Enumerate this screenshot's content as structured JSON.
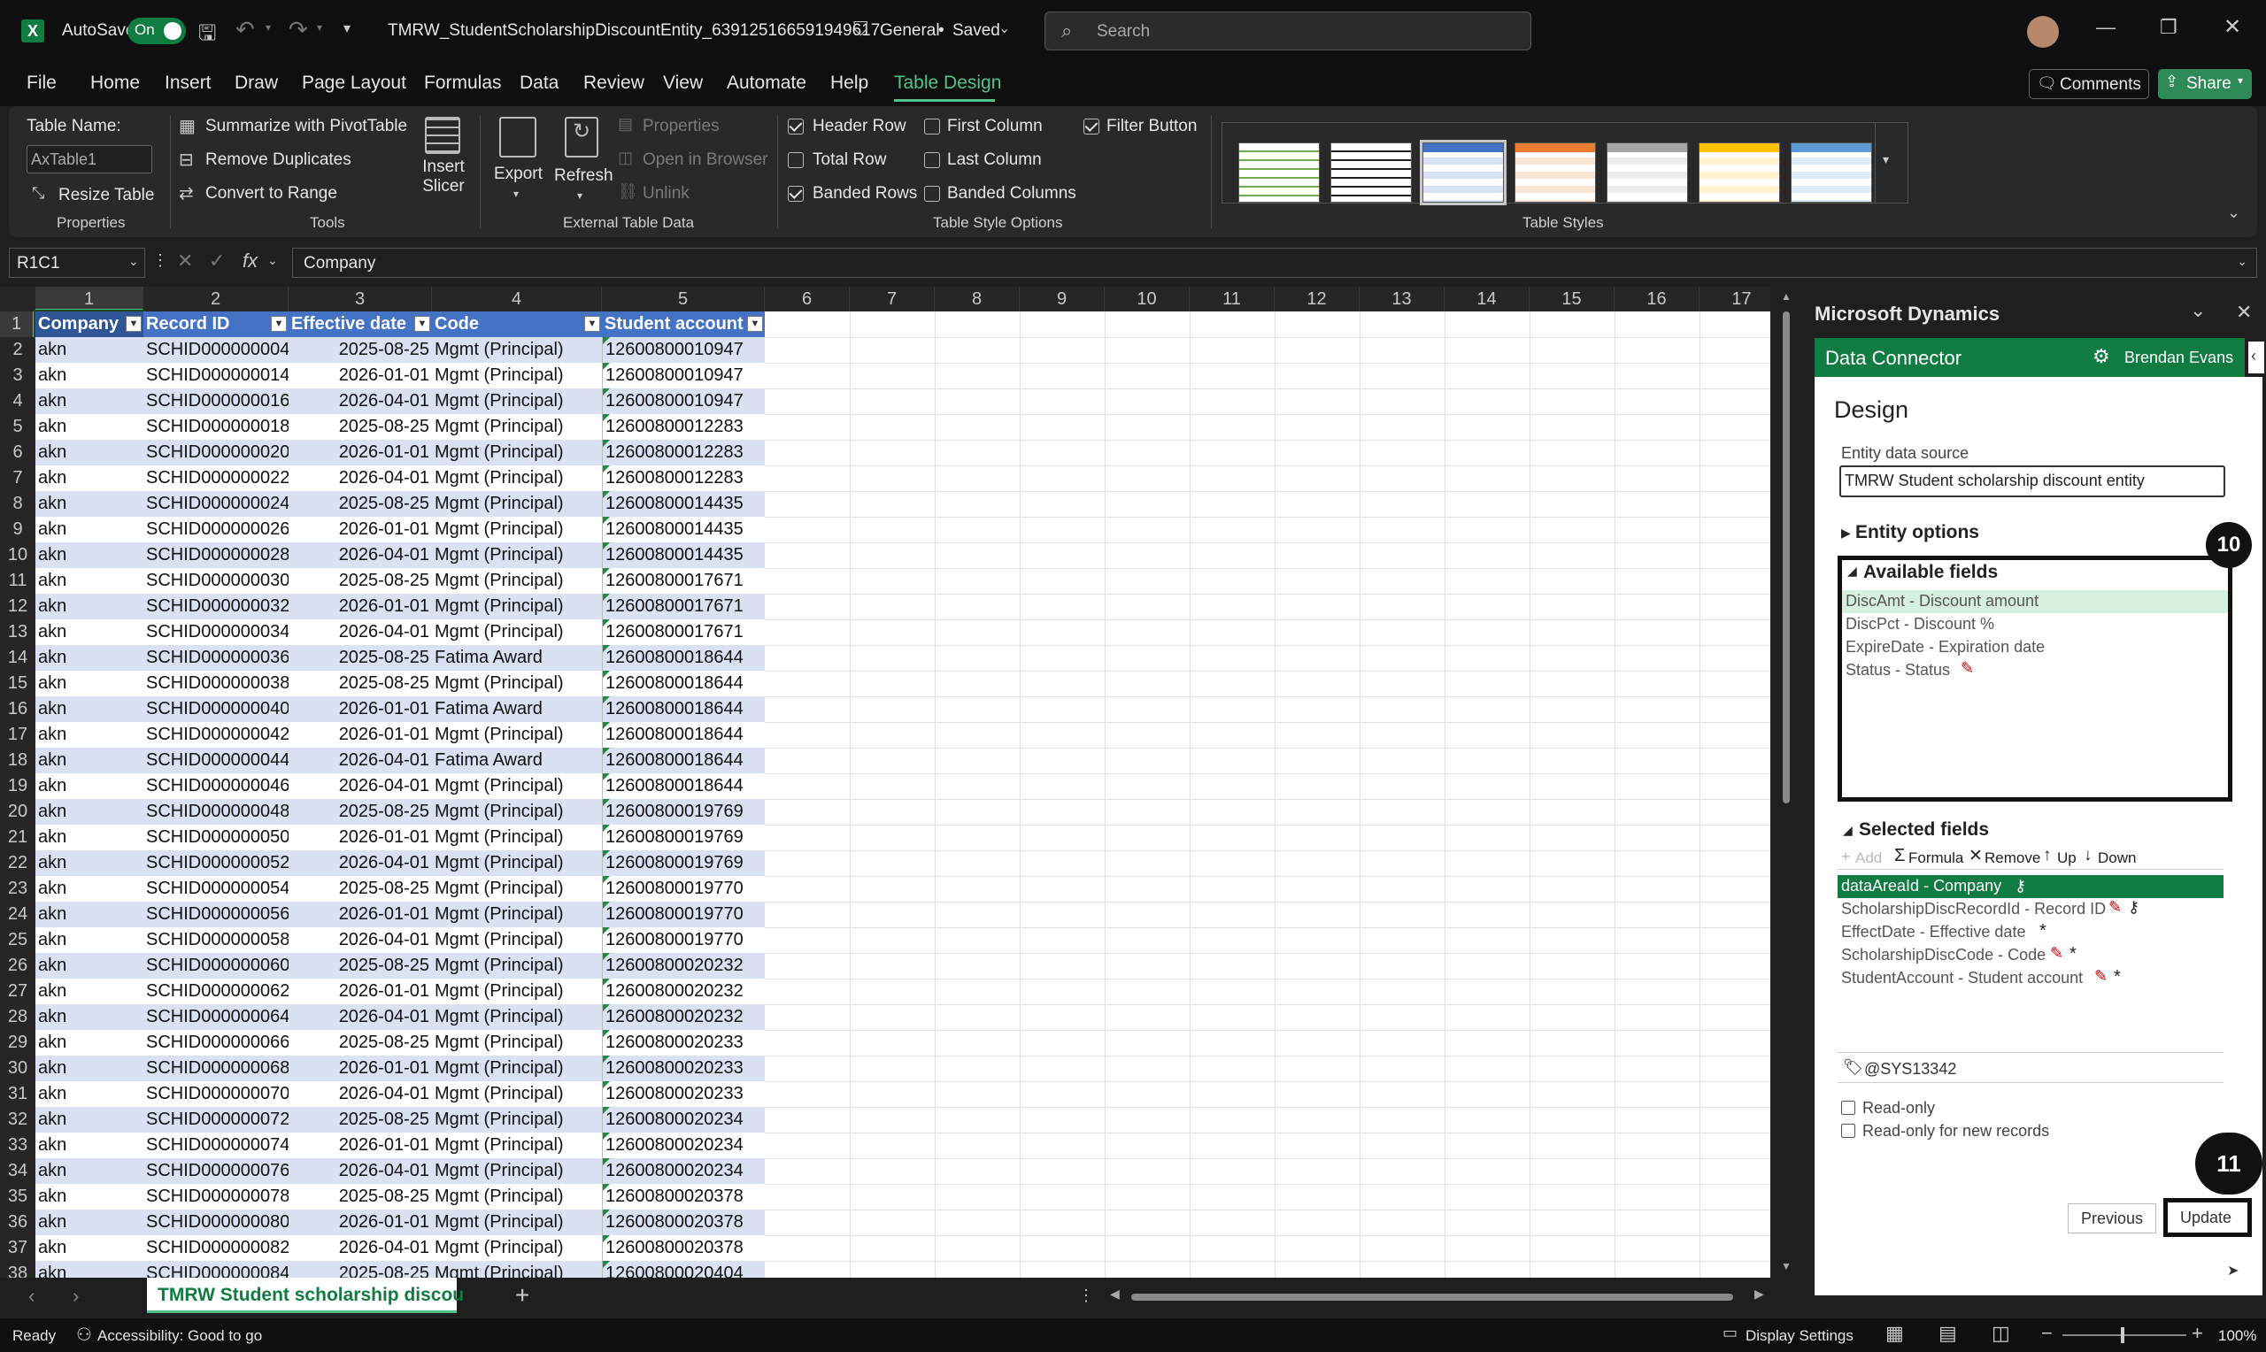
{
  "titlebar": {
    "autosave_label": "AutoSave",
    "autosave_state": "On",
    "filename": "TMRW_StudentScholarshipDiscountEntity_639125166591949617",
    "sensitivity": "General",
    "save_state": "Saved",
    "search_placeholder": "Search"
  },
  "menu": [
    "File",
    "Home",
    "Insert",
    "Draw",
    "Page Layout",
    "Formulas",
    "Data",
    "Review",
    "View",
    "Automate",
    "Help",
    "Table Design"
  ],
  "menu_active": "Table Design",
  "menu_buttons": {
    "comments": "Comments",
    "share": "Share"
  },
  "ribbon": {
    "properties": {
      "table_name_label": "Table Name:",
      "table_name_value": "AxTable1",
      "resize": "Resize Table",
      "group": "Properties"
    },
    "tools": {
      "pivot": "Summarize with PivotTable",
      "dupes": "Remove Duplicates",
      "range": "Convert to Range",
      "slicer": "Insert Slicer",
      "group": "Tools"
    },
    "external": {
      "export": "Export",
      "refresh": "Refresh",
      "props": "Properties",
      "browser": "Open in Browser",
      "unlink": "Unlink",
      "group": "External Table Data"
    },
    "style_options": {
      "header_row": "Header Row",
      "total_row": "Total Row",
      "banded_rows": "Banded Rows",
      "first_column": "First Column",
      "last_column": "Last Column",
      "banded_columns": "Banded Columns",
      "filter_button": "Filter Button",
      "group": "Table Style Options"
    },
    "styles": {
      "group": "Table Styles"
    }
  },
  "formula_bar": {
    "name_box": "R1C1",
    "content": "Company"
  },
  "columns": [
    "1",
    "2",
    "3",
    "4",
    "5",
    "6",
    "7",
    "8",
    "9",
    "10",
    "11",
    "12",
    "13",
    "14",
    "15",
    "16",
    "17"
  ],
  "table_headers": [
    "Company",
    "Record ID",
    "Effective date",
    "Code",
    "Student account"
  ],
  "rows": [
    [
      "akn",
      "SCHID000000004",
      "2025-08-25",
      "Mgmt (Principal)",
      "12600800010947"
    ],
    [
      "akn",
      "SCHID000000014",
      "2026-01-01",
      "Mgmt (Principal)",
      "12600800010947"
    ],
    [
      "akn",
      "SCHID000000016",
      "2026-04-01",
      "Mgmt (Principal)",
      "12600800010947"
    ],
    [
      "akn",
      "SCHID000000018",
      "2025-08-25",
      "Mgmt (Principal)",
      "12600800012283"
    ],
    [
      "akn",
      "SCHID000000020",
      "2026-01-01",
      "Mgmt (Principal)",
      "12600800012283"
    ],
    [
      "akn",
      "SCHID000000022",
      "2026-04-01",
      "Mgmt (Principal)",
      "12600800012283"
    ],
    [
      "akn",
      "SCHID000000024",
      "2025-08-25",
      "Mgmt (Principal)",
      "12600800014435"
    ],
    [
      "akn",
      "SCHID000000026",
      "2026-01-01",
      "Mgmt (Principal)",
      "12600800014435"
    ],
    [
      "akn",
      "SCHID000000028",
      "2026-04-01",
      "Mgmt (Principal)",
      "12600800014435"
    ],
    [
      "akn",
      "SCHID000000030",
      "2025-08-25",
      "Mgmt (Principal)",
      "12600800017671"
    ],
    [
      "akn",
      "SCHID000000032",
      "2026-01-01",
      "Mgmt (Principal)",
      "12600800017671"
    ],
    [
      "akn",
      "SCHID000000034",
      "2026-04-01",
      "Mgmt (Principal)",
      "12600800017671"
    ],
    [
      "akn",
      "SCHID000000036",
      "2025-08-25",
      "Fatima Award",
      "12600800018644"
    ],
    [
      "akn",
      "SCHID000000038",
      "2025-08-25",
      "Mgmt (Principal)",
      "12600800018644"
    ],
    [
      "akn",
      "SCHID000000040",
      "2026-01-01",
      "Fatima Award",
      "12600800018644"
    ],
    [
      "akn",
      "SCHID000000042",
      "2026-01-01",
      "Mgmt (Principal)",
      "12600800018644"
    ],
    [
      "akn",
      "SCHID000000044",
      "2026-04-01",
      "Fatima Award",
      "12600800018644"
    ],
    [
      "akn",
      "SCHID000000046",
      "2026-04-01",
      "Mgmt (Principal)",
      "12600800018644"
    ],
    [
      "akn",
      "SCHID000000048",
      "2025-08-25",
      "Mgmt (Principal)",
      "12600800019769"
    ],
    [
      "akn",
      "SCHID000000050",
      "2026-01-01",
      "Mgmt (Principal)",
      "12600800019769"
    ],
    [
      "akn",
      "SCHID000000052",
      "2026-04-01",
      "Mgmt (Principal)",
      "12600800019769"
    ],
    [
      "akn",
      "SCHID000000054",
      "2025-08-25",
      "Mgmt (Principal)",
      "12600800019770"
    ],
    [
      "akn",
      "SCHID000000056",
      "2026-01-01",
      "Mgmt (Principal)",
      "12600800019770"
    ],
    [
      "akn",
      "SCHID000000058",
      "2026-04-01",
      "Mgmt (Principal)",
      "12600800019770"
    ],
    [
      "akn",
      "SCHID000000060",
      "2025-08-25",
      "Mgmt (Principal)",
      "12600800020232"
    ],
    [
      "akn",
      "SCHID000000062",
      "2026-01-01",
      "Mgmt (Principal)",
      "12600800020232"
    ],
    [
      "akn",
      "SCHID000000064",
      "2026-04-01",
      "Mgmt (Principal)",
      "12600800020232"
    ],
    [
      "akn",
      "SCHID000000066",
      "2025-08-25",
      "Mgmt (Principal)",
      "12600800020233"
    ],
    [
      "akn",
      "SCHID000000068",
      "2026-01-01",
      "Mgmt (Principal)",
      "12600800020233"
    ],
    [
      "akn",
      "SCHID000000070",
      "2026-04-01",
      "Mgmt (Principal)",
      "12600800020233"
    ],
    [
      "akn",
      "SCHID000000072",
      "2025-08-25",
      "Mgmt (Principal)",
      "12600800020234"
    ],
    [
      "akn",
      "SCHID000000074",
      "2026-01-01",
      "Mgmt (Principal)",
      "12600800020234"
    ],
    [
      "akn",
      "SCHID000000076",
      "2026-04-01",
      "Mgmt (Principal)",
      "12600800020234"
    ],
    [
      "akn",
      "SCHID000000078",
      "2025-08-25",
      "Mgmt (Principal)",
      "12600800020378"
    ],
    [
      "akn",
      "SCHID000000080",
      "2026-01-01",
      "Mgmt (Principal)",
      "12600800020378"
    ],
    [
      "akn",
      "SCHID000000082",
      "2026-04-01",
      "Mgmt (Principal)",
      "12600800020378"
    ],
    [
      "akn",
      "SCHID000000084",
      "2025-08-25",
      "Mgmt (Principal)",
      "12600800020404"
    ]
  ],
  "sheet_tab": "TMRW Student scholarship discou",
  "pane": {
    "title": "Microsoft Dynamics",
    "connector": "Data Connector",
    "user": "Brendan Evans",
    "design": "Design",
    "entity_label": "Entity data source",
    "entity_value": "TMRW Student scholarship discount entity",
    "entity_options": "Entity options",
    "available_fields": "Available fields",
    "available": [
      "DiscAmt - Discount amount",
      "DiscPct - Discount %",
      "ExpireDate - Expiration date",
      "Status - Status"
    ],
    "selected_fields": "Selected fields",
    "toolbar": {
      "add": "Add",
      "formula": "Formula",
      "remove": "Remove",
      "up": "Up",
      "down": "Down"
    },
    "selected": [
      "dataAreaId - Company",
      "ScholarshipDiscRecordId - Record ID",
      "EffectDate - Effective date",
      "ScholarshipDiscCode - Code",
      "StudentAccount - Student account"
    ],
    "label_value": "@SYS13342",
    "readonly": "Read-only",
    "readonly_new": "Read-only for new records",
    "previous": "Previous",
    "update": "Update",
    "badge_a": "10",
    "badge_b": "11"
  },
  "status": {
    "ready": "Ready",
    "accessibility": "Accessibility: Good to go",
    "display": "Display Settings",
    "zoom": "100%"
  },
  "colors": {
    "accent_green": "#107c41",
    "table_header": "#4472c4",
    "band": "#d9e1f2",
    "tab_active": "#4fc38a"
  }
}
